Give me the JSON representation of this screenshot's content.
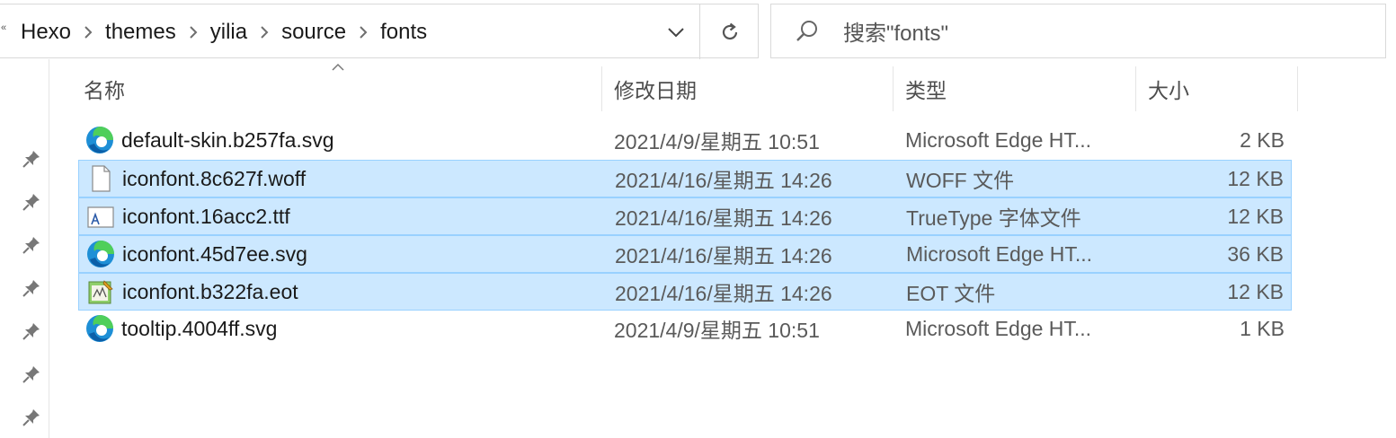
{
  "address_bar": {
    "overflow": "«",
    "crumbs": [
      "Hexo",
      "themes",
      "yilia",
      "source",
      "fonts"
    ]
  },
  "search": {
    "text": "搜索\"fonts\""
  },
  "columns": {
    "name": "名称",
    "date": "修改日期",
    "type": "类型",
    "size": "大小"
  },
  "files": [
    {
      "name": "default-skin.b257fa.svg",
      "date": "2021/4/9/星期五 10:51",
      "type": "Microsoft Edge HT...",
      "size": "2 KB",
      "icon": "edge-icon",
      "selected": false
    },
    {
      "name": "iconfont.8c627f.woff",
      "date": "2021/4/16/星期五 14:26",
      "type": "WOFF 文件",
      "size": "12 KB",
      "icon": "blank-file-icon",
      "selected": true
    },
    {
      "name": "iconfont.16acc2.ttf",
      "date": "2021/4/16/星期五 14:26",
      "type": "TrueType 字体文件",
      "size": "12 KB",
      "icon": "font-file-icon",
      "selected": true
    },
    {
      "name": "iconfont.45d7ee.svg",
      "date": "2021/4/16/星期五 14:26",
      "type": "Microsoft Edge HT...",
      "size": "36 KB",
      "icon": "edge-icon",
      "selected": true
    },
    {
      "name": "iconfont.b322fa.eot",
      "date": "2021/4/16/星期五 14:26",
      "type": "EOT 文件",
      "size": "12 KB",
      "icon": "eot-file-icon",
      "selected": true
    },
    {
      "name": "tooltip.4004ff.svg",
      "date": "2021/4/9/星期五 10:51",
      "type": "Microsoft Edge HT...",
      "size": "1 KB",
      "icon": "edge-icon",
      "selected": false
    }
  ],
  "colors": {
    "selection_bg": "#cce8ff",
    "selection_border": "#99d1ff"
  }
}
